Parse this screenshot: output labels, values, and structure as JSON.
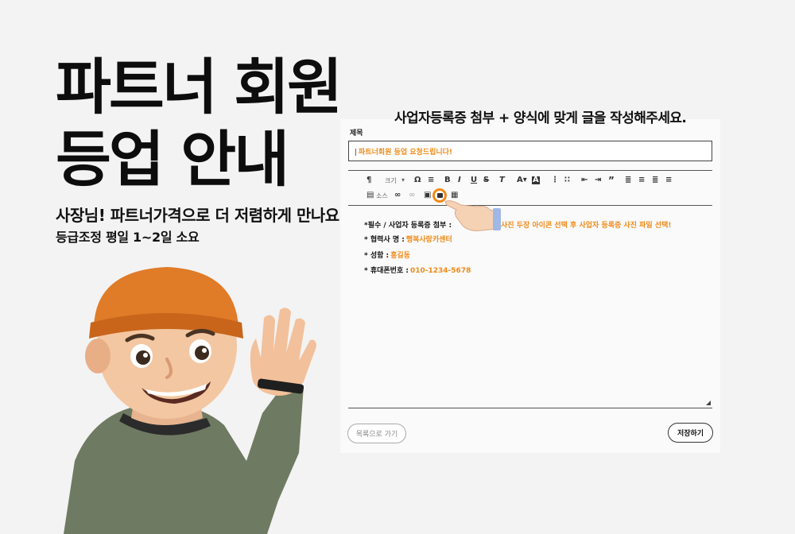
{
  "promo": {
    "title_line1": "파트너 회원",
    "title_line2": "등업 안내",
    "subtitle1": "사장님! 파트너가격으로 더 저렴하게 만나요!",
    "subtitle2": "등급조정 평일 1~2일 소요"
  },
  "editor": {
    "instruction": "사업자등록증 첨부 + 양식에 맞게 글을 작성해주세요.",
    "subject_label": "제목",
    "subject_value": "파트너회원 등업 요청드립니다!",
    "toolbar": {
      "size_label": "크기",
      "source_label": "소스"
    },
    "body": [
      {
        "label": "*필수 / 사업자 등록증 첨부 :",
        "value": ""
      },
      {
        "label": "* 협력사 명 :",
        "value": "행복사랑카센터"
      },
      {
        "label": "* 성함 :",
        "value": "홍길동"
      },
      {
        "label": "* 휴대폰번호 :",
        "value": "010-1234-5678"
      }
    ],
    "hint": "사진 두장 아이콘 선택 후 사업자 등록증 사진 파일 선택!",
    "list_button": "목록으로 가기",
    "save_button": "저장하기"
  },
  "colors": {
    "accent": "#f08a18",
    "background": "#f3f3f3"
  }
}
